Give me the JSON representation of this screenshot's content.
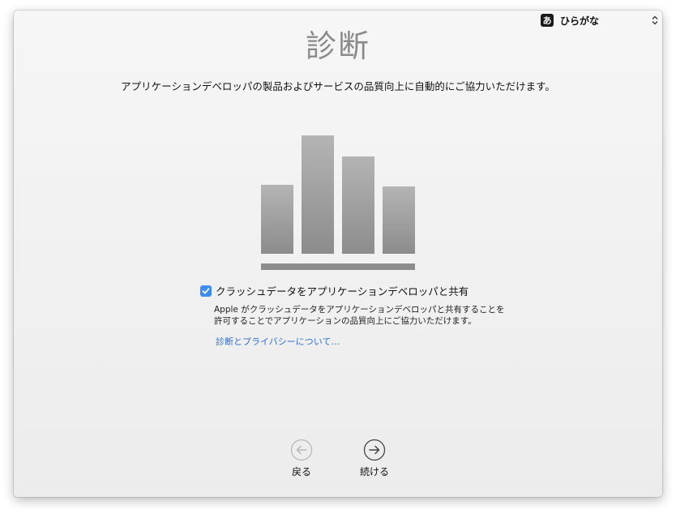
{
  "input_menu": {
    "icon_glyph": "あ",
    "label": "ひらがな"
  },
  "page": {
    "title": "診断",
    "subtitle": "アプリケーションデベロッパの製品およびサービスの品質向上に自動的にご協力いただけます。"
  },
  "illustration": {
    "icon": "bar-chart-icon",
    "bar_values": [
      0.57,
      0.97,
      0.8,
      0.55
    ]
  },
  "share_crash": {
    "checked": true,
    "label": "クラッシュデータをアプリケーションデベロッパと共有",
    "description_line1": "Apple がクラッシュデータをアプリケーションデベロッパと共有することを",
    "description_line2": "許可することでアプリケーションの品質向上にご協力いただけます。",
    "link": "診断とプライバシーについて…"
  },
  "navigation": {
    "back_label": "戻る",
    "continue_label": "続ける"
  },
  "colors": {
    "accent": "#3b8df4",
    "link": "#2f6fd4",
    "title": "#8a8a8a"
  }
}
